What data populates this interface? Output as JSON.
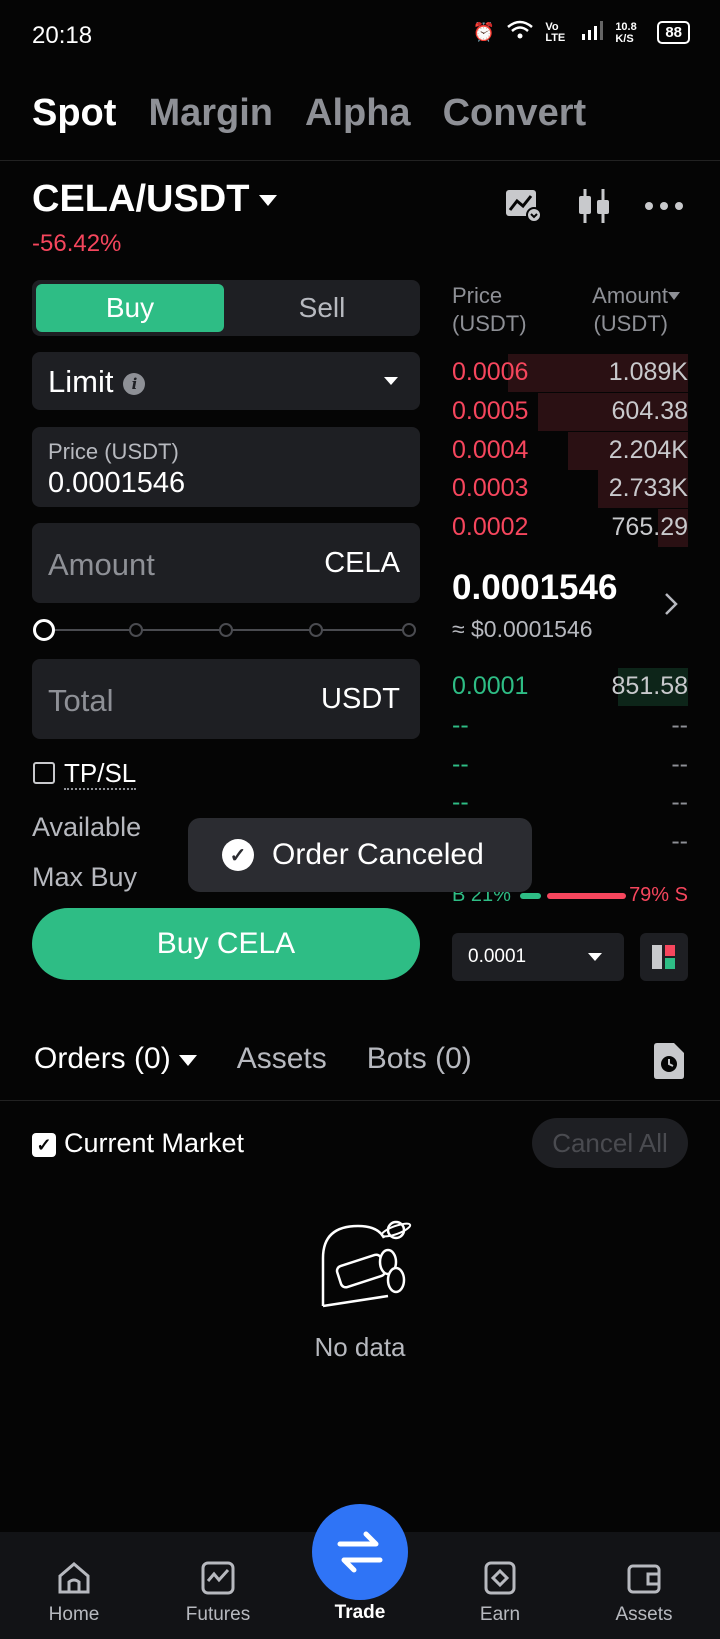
{
  "status": {
    "time": "20:18",
    "net_speed": "10.8 K/S",
    "volte": "Vo LTE",
    "battery": "88"
  },
  "top_tabs": [
    "Spot",
    "Margin",
    "Alpha",
    "Convert"
  ],
  "pair": {
    "name": "CELA/USDT",
    "change": "-56.42%"
  },
  "form": {
    "buy": "Buy",
    "sell": "Sell",
    "order_type": "Limit",
    "price_label": "Price (USDT)",
    "price_value": "0.0001546",
    "amount_placeholder": "Amount",
    "amount_unit": "CELA",
    "total_placeholder": "Total",
    "total_unit": "USDT",
    "tpsl": "TP/SL",
    "available_label": "Available",
    "max_buy_label": "Max Buy",
    "submit": "Buy CELA",
    "slider_percent": 0
  },
  "orderbook": {
    "price_header": "Price\n(USDT)",
    "amount_header": "Amount\n(USDT)",
    "asks": [
      {
        "price": "0.0006",
        "amount": "1.089K"
      },
      {
        "price": "0.0005",
        "amount": "604.38"
      },
      {
        "price": "0.0004",
        "amount": "2.204K"
      },
      {
        "price": "0.0003",
        "amount": "2.733K"
      },
      {
        "price": "0.0002",
        "amount": "765.29"
      }
    ],
    "last_price": "0.0001546",
    "last_price_usd": "≈ $0.0001546",
    "bids": [
      {
        "price": "0.0001",
        "amount": "851.58"
      },
      {
        "price": "--",
        "amount": "--"
      },
      {
        "price": "--",
        "amount": "--"
      },
      {
        "price": "--",
        "amount": "--"
      },
      {
        "price": "--",
        "amount": "--"
      }
    ],
    "buy_ratio": "B 21%",
    "sell_ratio": "79% S",
    "buy_ratio_value": 21,
    "depth": "0.0001"
  },
  "toast": {
    "text": "Order Canceled"
  },
  "orders": {
    "tabs": [
      "Orders (0)",
      "Assets",
      "Bots (0)"
    ],
    "current_market": "Current Market",
    "cancel_all": "Cancel All",
    "empty": "No data"
  },
  "nav": [
    "Home",
    "Futures",
    "Trade",
    "Earn",
    "Assets"
  ],
  "colors": {
    "buy": "#2ebd85",
    "sell": "#f6465d",
    "accent": "#2f74f6"
  }
}
